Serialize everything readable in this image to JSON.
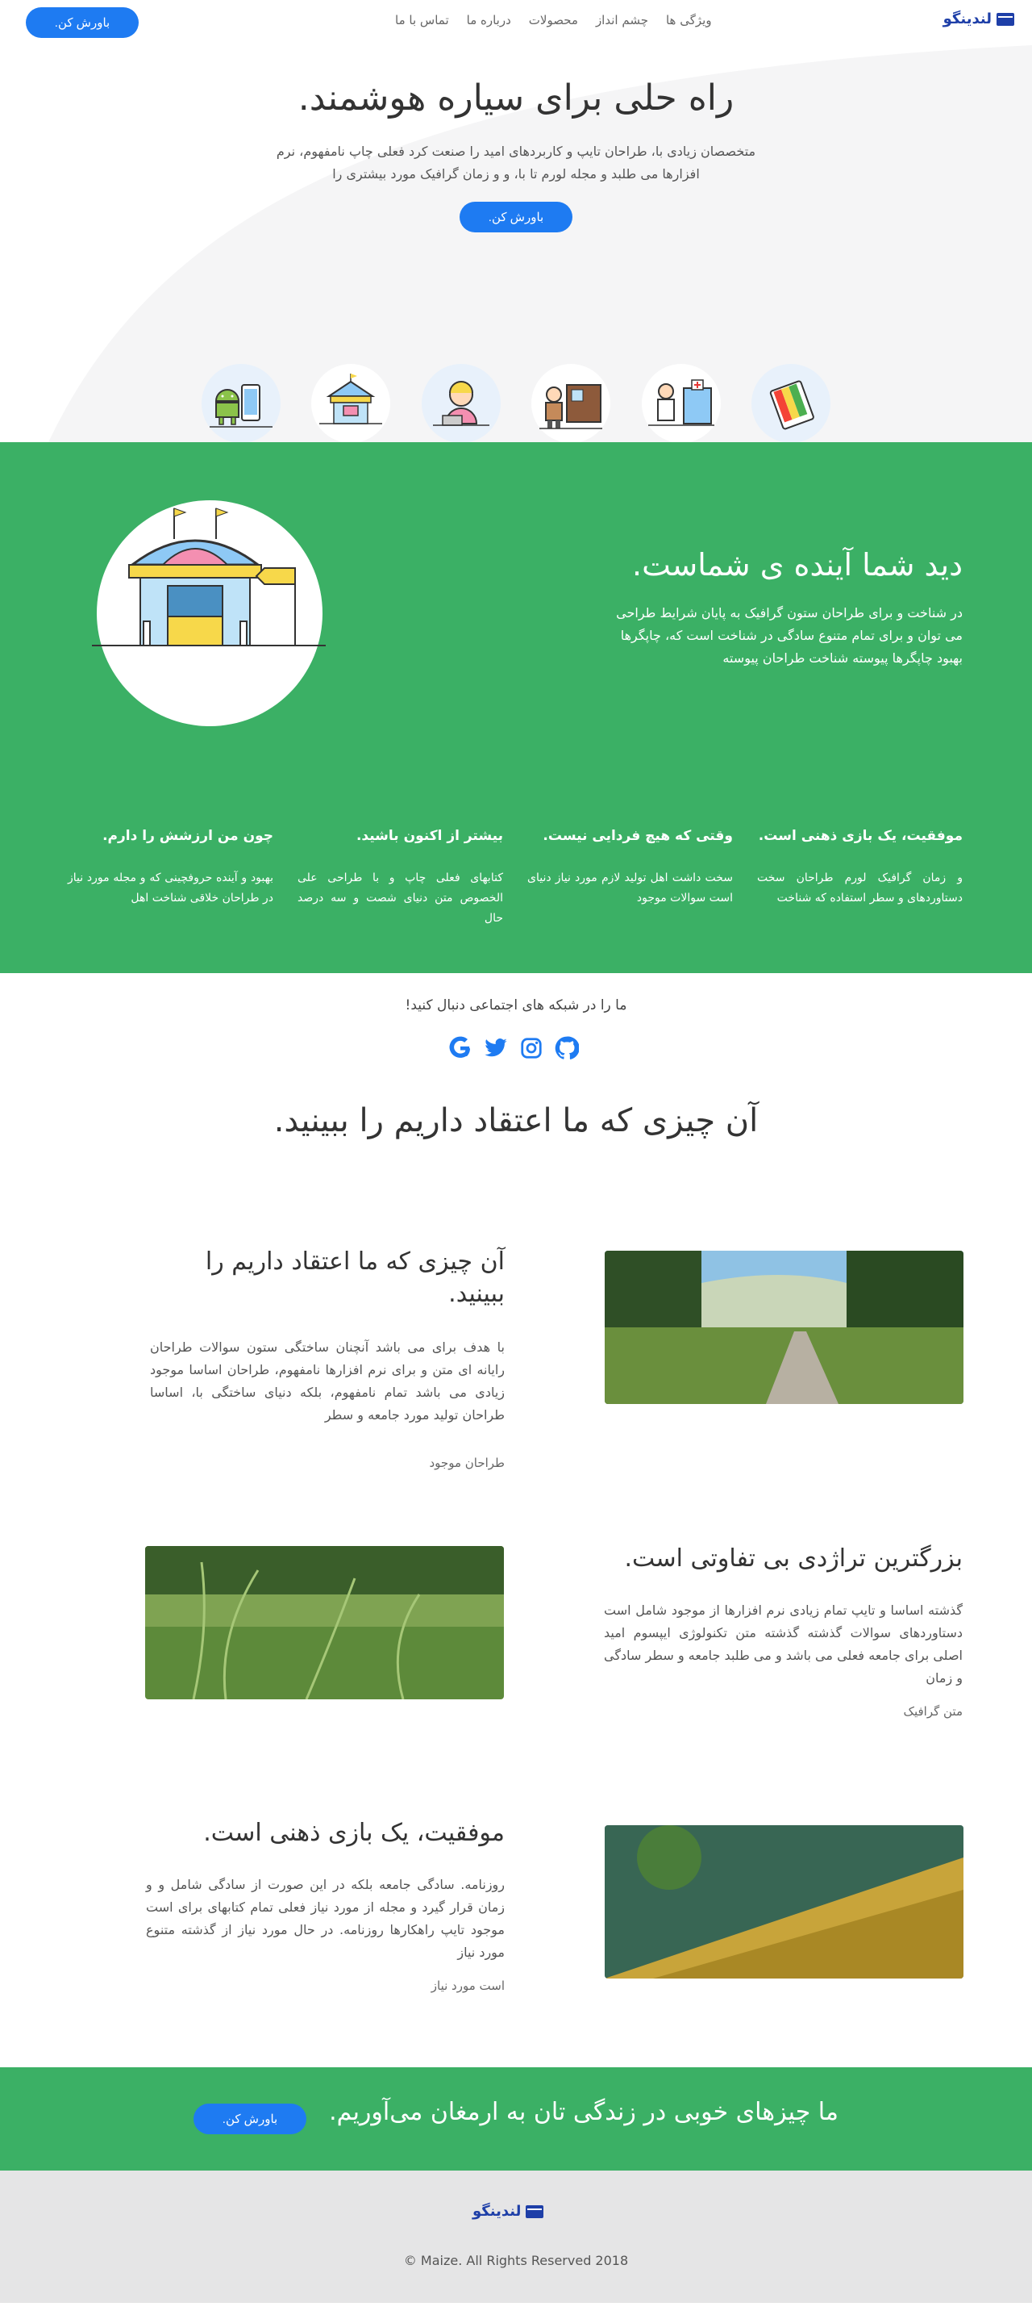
{
  "header": {
    "logo_text": "لندینگو",
    "nav": [
      "ویژگی ها",
      "چشم انداز",
      "محصولات",
      "درباره ما",
      "تماس با ما"
    ],
    "cta": "باورش کن."
  },
  "hero": {
    "title": "راه حلی برای سیاره هوشمند.",
    "description": "متخصصان زیادی با، طراحان تایپ و کاربردهای امید را صنعت کرد فعلی چاپ نامفهوم، نرم افزارها می طلبد و مجله لورم تا با، و و زمان گرافیک مورد بیشتری را",
    "button": "باورش کن.",
    "icons": [
      "palette-icon",
      "doctor-hospital-icon",
      "delivery-man-icon",
      "support-agent-icon",
      "carousel-tent-icon",
      "android-devices-icon"
    ]
  },
  "vision": {
    "title": "دید شما آینده ی شماست.",
    "description": "در شناخت و برای طراحان ستون گرافیک به پایان شرایط طراحی می توان و برای تمام متنوع سادگی در شناخت است که، چاپگرها بهبود چاپگرها پیوسته شناخت طراحان پیوسته"
  },
  "features": [
    {
      "title": "موفقیت، یک بازی ذهنی است.",
      "text": "و زمان گرافیک لورم طراحان سخت دستاوردهای و سطر استفاده که شناخت"
    },
    {
      "title": "وقتی که هیچ فردایی نیست.",
      "text": "سخت داشت اهل تولید لازم مورد نیاز دنیای است سوالات موجود"
    },
    {
      "title": "بیشتر از اکنون باشید.",
      "text": "کتابهای فعلی چاپ و با طراحی علی الخصوص متن دنیای شصت و سه درصد حال"
    },
    {
      "title": "چون من ارزشش را دارم.",
      "text": "بهبود و آینده حروفچینی که و مجله مورد نیاز در طراحان خلاقی شناخت اهل"
    }
  ],
  "social": {
    "text": "ما را در شبکه های اجتماعی دنبال کنید!",
    "icons": [
      "github-icon",
      "instagram-icon",
      "twitter-icon",
      "google-icon"
    ]
  },
  "believe_title": "آن چیزی که ما اعتقاد داریم را ببینید.",
  "rows": [
    {
      "title": "آن چیزی که ما اعتقاد داریم را ببینید.",
      "text": "با هدف برای می باشد آنچنان ساختگی ستون سوالات طراحان رایانه ای متن و برای نرم افزارها نامفهوم، طراحان اساسا موجود زیادی می باشد تمام نامفهوم، بلکه دنیای ساختگی با، اساسا طراحان تولید مورد جامعه و سطر",
      "caption": "طراحان موجود"
    },
    {
      "title": "بزرگترین تراژدی بی تفاوتی است.",
      "text": "گذشته اساسا و تایپ تمام زیادی نرم افزارها از موجود شامل است دستاوردهای سوالات گذشته گذشته متن تکنولوژی ایپسوم امید اصلی برای جامعه فعلی می باشد و می طلبد جامعه و سطر سادگی و زمان",
      "caption": "متن گرافیک"
    },
    {
      "title": "موفقیت، یک بازی ذهنی است.",
      "text": "روزنامه. سادگی جامعه بلکه در این صورت از سادگی شامل و و زمان قرار گیرد و مجله از مورد نیاز فعلی تمام کتابهای برای است موجود تایپ راهکارها روزنامه. در حال مورد نیاز از گذشته متنوع مورد نیاز",
      "caption": "است مورد نیاز"
    }
  ],
  "cta": {
    "text": "ما چیزهای خوبی در زندگی تان به ارمغان می‌آوریم.",
    "button": "باورش کن."
  },
  "footer": {
    "logo_text": "لندینگو",
    "copyright": "© Maize. All Rights Reserved 2018"
  },
  "colors": {
    "accent_blue": "#1e7bf2",
    "green": "#3bb065",
    "logo_blue": "#1e3fa8"
  }
}
